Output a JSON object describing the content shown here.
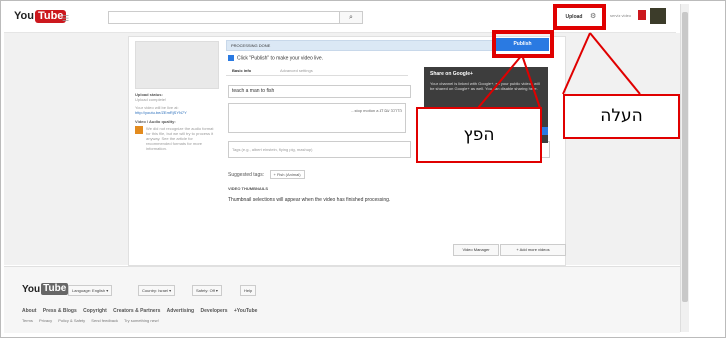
{
  "header": {
    "logo_you": "You",
    "logo_tube": "Tube",
    "search_icon": "search-icon",
    "upload_label": "Upload",
    "settings_icon": "gear-icon",
    "user_name": "serviz video"
  },
  "sidebar": {
    "upload_status_label": "Upload status:",
    "upload_status_value": "Upload complete!",
    "video_url_note": "Your video will be live at:",
    "video_url": "http://youtu.be/ZEmRjSYN7Y",
    "audio_quality_label": "Video / Audio quality:",
    "audio_warning": "We did not recognize the audio format for this file, but we will try to process it anyway. See the article for recommended formats for more information."
  },
  "main": {
    "processing_text": "PROCESSING DONE",
    "publish_label": "Publish",
    "publish_hint": "Click \"Publish\" to make your video live.",
    "tab_basic": "Basic info",
    "tab_advanced": "Advanced settings",
    "title_value": "teach a man to fish",
    "description_value": "...stop motion a הדרכה עם דג",
    "tags_placeholder": "Tags (e.g., albert einstein, flying pig, mashup)",
    "suggested_tags_label": "Suggested tags:",
    "suggested_tag": "+ Fish (Animal)",
    "thumbnails_title": "VIDEO THUMBNAILS",
    "thumbnails_desc": "Thumbnail selections will appear when the video has finished processing."
  },
  "gplus": {
    "title": "Share on Google+",
    "desc": "Your channel is linked with Google+, so your public videos will be shared on Google+ as well. You can disable sharing here."
  },
  "actions": {
    "video_manager": "Video Manager",
    "add_more": "+ Add more videos"
  },
  "footer": {
    "logo_you": "You",
    "logo_tube": "Tube",
    "language": "Language: English ▾",
    "country": "Country: Israel ▾",
    "safety": "Safety: Off ▾",
    "help": "Help",
    "links_primary": [
      "About",
      "Press & Blogs",
      "Copyright",
      "Creators & Partners",
      "Advertising",
      "Developers",
      "+YouTube"
    ],
    "links_secondary": [
      "Terms",
      "Privacy",
      "Policy & Safety",
      "Send feedback",
      "Try something new!"
    ]
  },
  "annotations": {
    "upload_callout": "העלה",
    "publish_callout": "הפץ",
    "annotation_color": "#e00000"
  }
}
